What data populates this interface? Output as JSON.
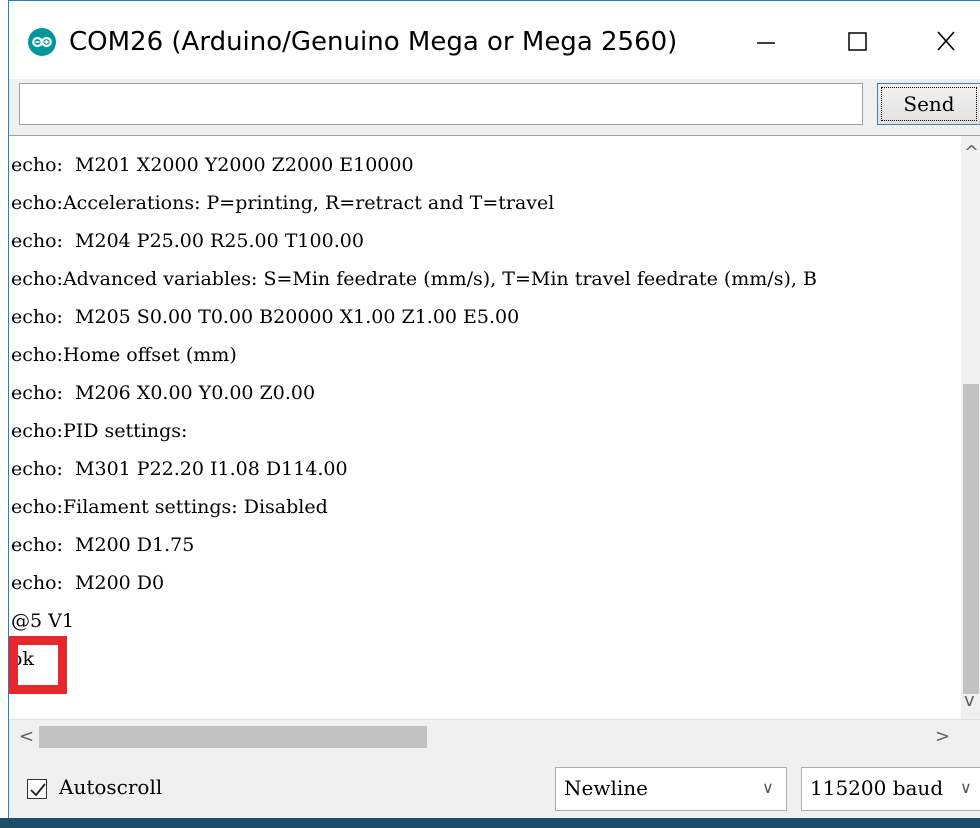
{
  "window": {
    "title": "COM26 (Arduino/Genuino Mega or Mega 2560)",
    "minimize_glyph": "—",
    "maximize_glyph": "☐",
    "close_glyph": "✕",
    "icon": "arduino-logo-icon",
    "brand_color": "#00979c"
  },
  "input": {
    "value": "",
    "placeholder": "",
    "send_label": "Send"
  },
  "console": {
    "lines": [
      "echo:  M201 X2000 Y2000 Z2000 E10000",
      "echo:Accelerations: P=printing, R=retract and T=travel",
      "echo:  M204 P25.00 R25.00 T100.00",
      "echo:Advanced variables: S=Min feedrate (mm/s), T=Min travel feedrate (mm/s), B",
      "echo:  M205 S0.00 T0.00 B20000 X1.00 Z1.00 E5.00",
      "echo:Home offset (mm)",
      "echo:  M206 X0.00 Y0.00 Z0.00",
      "echo:PID settings:",
      "echo:  M301 P22.20 I1.08 D114.00",
      "echo:Filament settings: Disabled",
      "echo:  M200 D1.75",
      "echo:  M200 D0",
      "@5 V1",
      "ok"
    ],
    "highlight_color": "#e8272b"
  },
  "scroll": {
    "left_arrow": "<",
    "right_arrow": ">",
    "up_arrow": "^",
    "down_arrow": "v"
  },
  "footer": {
    "autoscroll_label": "Autoscroll",
    "autoscroll_checked": true,
    "line_ending": "Newline",
    "baud_rate": "115200 baud",
    "dropdown_arrow": "∨"
  }
}
